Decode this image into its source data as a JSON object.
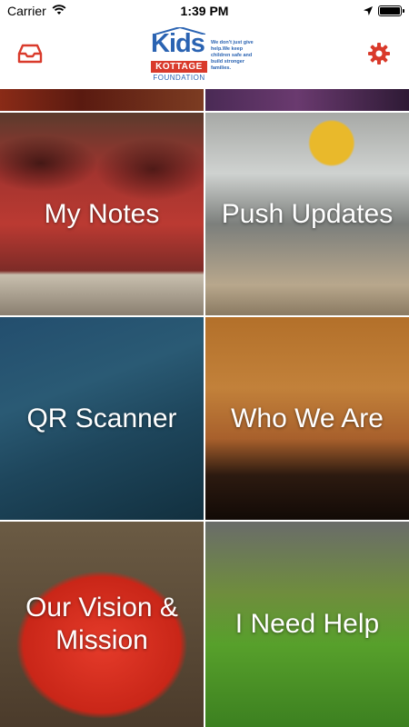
{
  "status_bar": {
    "carrier": "Carrier",
    "time": "1:39 PM",
    "wifi_icon": "wifi-icon",
    "location_icon": "location-arrow-icon",
    "battery_level": 1.0
  },
  "header": {
    "inbox_icon": "inbox-icon",
    "settings_icon": "gear-icon",
    "logo": {
      "kids": "Kids",
      "kottage": "KOTTAGE",
      "foundation": "FOUNDATION",
      "tagline": "We don't just give help.We keep children safe and build stronger families."
    },
    "accent_color": "#d93a2b"
  },
  "tiles": [
    {
      "label": "My Notes"
    },
    {
      "label": "Push Updates"
    },
    {
      "label": "QR Scanner"
    },
    {
      "label": "Who We Are"
    },
    {
      "label": "Our Vision & Mission"
    },
    {
      "label": "I Need Help"
    }
  ]
}
